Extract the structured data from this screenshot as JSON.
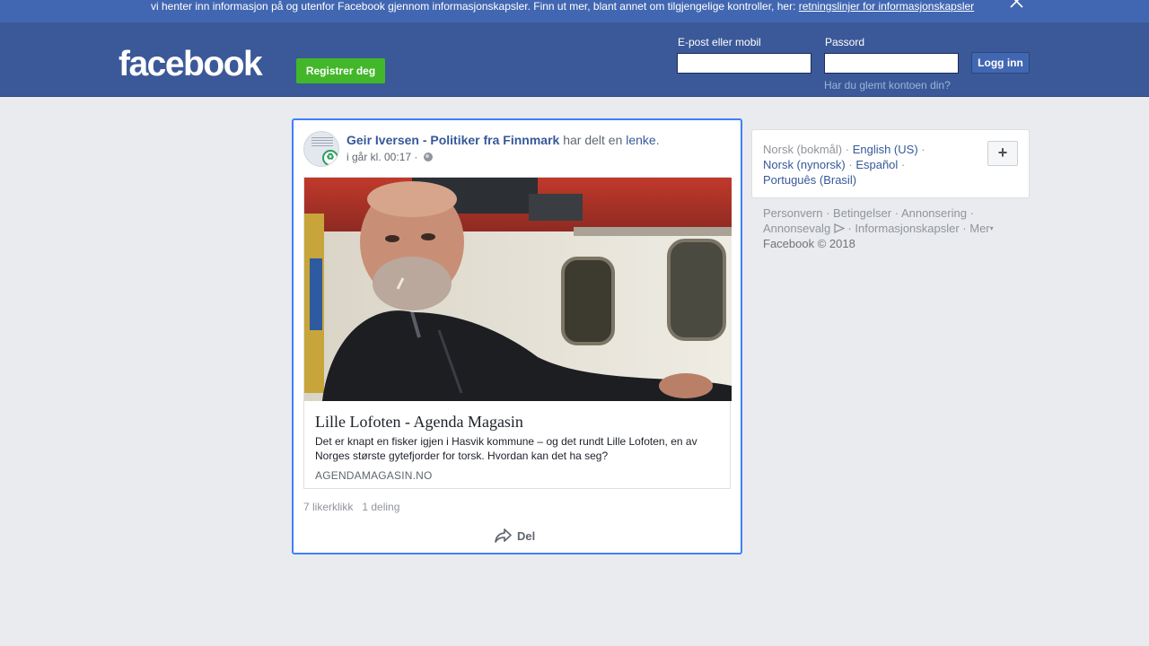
{
  "cookie_bar": {
    "text": "vi henter inn informasjon på og utenfor Facebook gjennom informasjonskapsler. Finn ut mer, blant annet om tilgjengelige kontroller, her: ",
    "link": "retningslinjer for informasjonskapsler"
  },
  "header": {
    "logo": "facebook",
    "register_label": "Registrer deg",
    "email_label": "E-post eller mobil",
    "password_label": "Passord",
    "login_label": "Logg inn",
    "forgot_label": "Har du glemt kontoen din?"
  },
  "post": {
    "author": "Geir Iversen - Politiker fra Finnmark",
    "shared_text": " har delt en ",
    "shared_link": "lenke",
    "period": ".",
    "timestamp": "i går kl. 00:17 · ",
    "link": {
      "title": "Lille Lofoten - Agenda Magasin",
      "description": "Det er knapt en fisker igjen i Hasvik kommune – og det rundt Lille Lofoten, en av Norges største gytefjorder for torsk. Hvordan kan det ha seg?",
      "domain": "AGENDAMAGASIN.NO"
    },
    "likes": "7 likerklikk",
    "shares": "1 deling",
    "share_label": "Del"
  },
  "languages": {
    "current": "Norsk (bokmål)",
    "sep": " · ",
    "options": [
      "English (US)",
      "Norsk (nynorsk)",
      "Español",
      "Português (Brasil)"
    ],
    "add_label": "+"
  },
  "footer": {
    "links": [
      "Personvern",
      "Betingelser",
      "Annonsering",
      "Annonsevalg",
      "Informasjonskapsler",
      "Mer"
    ],
    "copyright": "Facebook © 2018"
  },
  "colors": {
    "header_bg": "#3b5998",
    "cookie_bg": "#4267b2",
    "register_green": "#42b72a",
    "link_blue": "#365899",
    "focus_border": "#4080ff"
  }
}
